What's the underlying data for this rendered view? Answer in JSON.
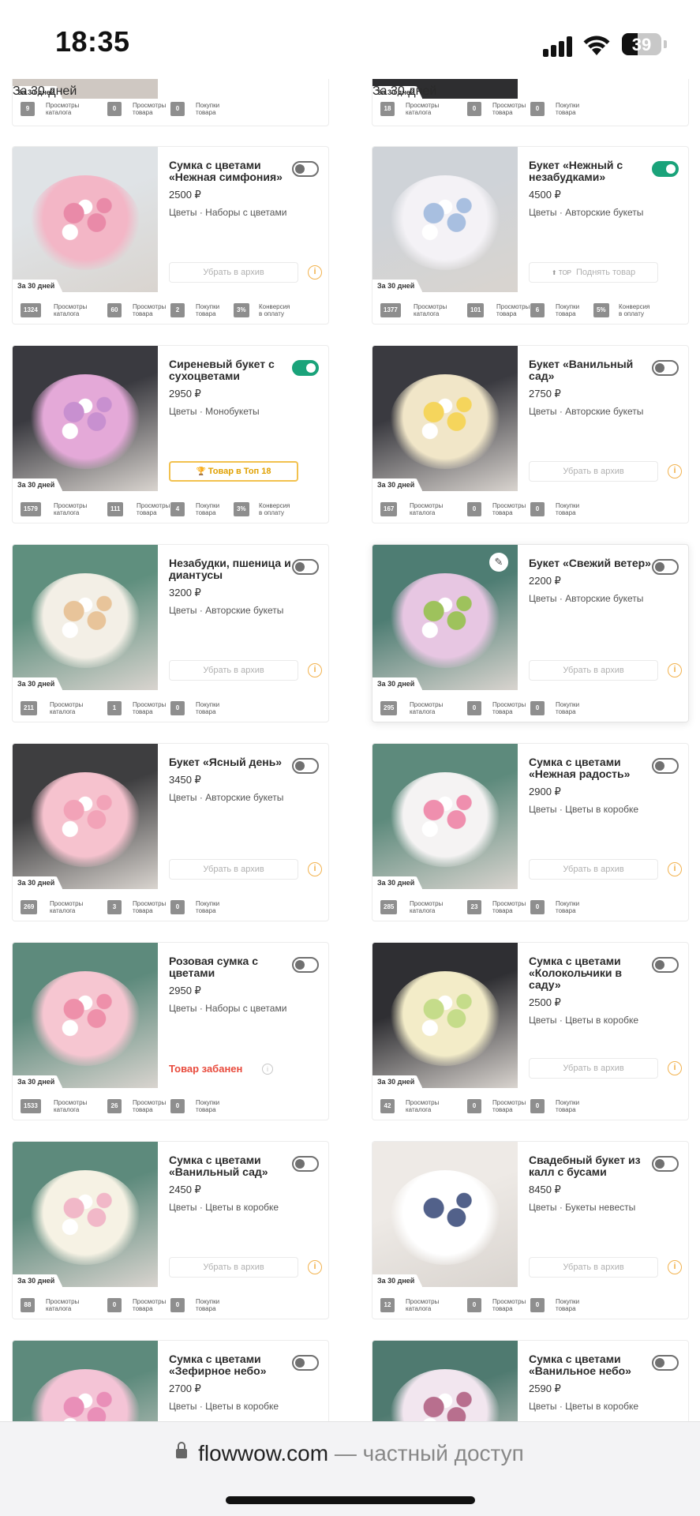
{
  "status": {
    "time": "18:35",
    "battery": "39"
  },
  "stat_labels": {
    "catalog": "Просмотры\nкаталога",
    "product": "Просмотры\nтовара",
    "purchases": "Покупки\nтовара",
    "conversion": "Конверсия\nв оплату"
  },
  "badge_30": "За 30 дней",
  "archive_label": "Убрать в архив",
  "top18_label": "Товар в Топ 18",
  "raise_label": "Поднять товар",
  "raise_mark": "TOP",
  "banned_label": "Товар забанен",
  "top_partial": [
    {
      "catalog": "9",
      "product": "0",
      "purchases": "0"
    },
    {
      "catalog": "18",
      "product": "0",
      "purchases": "0"
    }
  ],
  "products": [
    {
      "title": "Сумка с цветами «Нежная симфония»",
      "price": "2500 ₽",
      "category": "Цветы · Наборы с цветами",
      "enabled": false,
      "action": "archive",
      "stats": {
        "catalog": "1324",
        "product": "60",
        "purchases": "2",
        "conversion": "3%"
      },
      "colors": [
        "#dfe3e6",
        "#f3b6c6",
        "#e98aa8"
      ]
    },
    {
      "title": "Букет «Нежный с незабудками»",
      "price": "4500 ₽",
      "category": "Цветы · Авторские букеты",
      "enabled": true,
      "action": "raise",
      "stats": {
        "catalog": "1377",
        "product": "101",
        "purchases": "6",
        "conversion": "5%"
      },
      "colors": [
        "#cfd3d8",
        "#f4f2f6",
        "#a8bfe0"
      ]
    },
    {
      "title": "Сиреневый букет с сухоцветами",
      "price": "2950 ₽",
      "category": "Цветы · Монобукеты",
      "enabled": true,
      "action": "top18",
      "stats": {
        "catalog": "1579",
        "product": "111",
        "purchases": "4",
        "conversion": "3%"
      },
      "colors": [
        "#3a3a40",
        "#e4a9d8",
        "#c890d0"
      ]
    },
    {
      "title": "Букет «Ванильный сад»",
      "price": "2750 ₽",
      "category": "Цветы · Авторские букеты",
      "enabled": false,
      "action": "archive",
      "stats": {
        "catalog": "167",
        "product": "0",
        "purchases": "0"
      },
      "colors": [
        "#3a3a40",
        "#f1e6c8",
        "#f5d55c"
      ]
    },
    {
      "title": "Незабудки, пшеница и диантусы",
      "price": "3200 ₽",
      "category": "Цветы · Авторские букеты",
      "enabled": false,
      "action": "archive",
      "stats": {
        "catalog": "211",
        "product": "1",
        "purchases": "0"
      },
      "colors": [
        "#5f8f7e",
        "#f3efe6",
        "#e8c49a"
      ]
    },
    {
      "title": "Букет «Свежий ветер»",
      "price": "2200 ₽",
      "category": "Цветы · Авторские букеты",
      "enabled": false,
      "action": "archive",
      "stats": {
        "catalog": "295",
        "product": "0",
        "purchases": "0"
      },
      "colors": [
        "#4e7d73",
        "#e7c6e2",
        "#9ec25c"
      ],
      "edit": true
    },
    {
      "title": "Букет «Ясный день»",
      "price": "3450 ₽",
      "category": "Цветы · Авторские букеты",
      "enabled": false,
      "action": "archive",
      "stats": {
        "catalog": "269",
        "product": "3",
        "purchases": "0"
      },
      "colors": [
        "#3e3e40",
        "#f6c2ce",
        "#f2a3b8"
      ]
    },
    {
      "title": "Сумка с цветами «Нежная радость»",
      "price": "2900 ₽",
      "category": "Цветы · Цветы в коробке",
      "enabled": false,
      "action": "archive",
      "stats": {
        "catalog": "285",
        "product": "23",
        "purchases": "0"
      },
      "colors": [
        "#5d8a7c",
        "#f5f3f3",
        "#ef8fae"
      ]
    },
    {
      "title": "Розовая сумка с цветами",
      "price": "2950 ₽",
      "category": "Цветы · Наборы с цветами",
      "enabled": false,
      "action": "banned",
      "stats": {
        "catalog": "1533",
        "product": "26",
        "purchases": "0"
      },
      "colors": [
        "#5d8a7c",
        "#f6c6d1",
        "#ee90aa"
      ]
    },
    {
      "title": "Сумка с цветами «Колокольчики в саду»",
      "price": "2500 ₽",
      "category": "Цветы · Цветы в коробке",
      "enabled": false,
      "action": "archive",
      "stats": {
        "catalog": "42",
        "product": "0",
        "purchases": "0"
      },
      "colors": [
        "#2f2f33",
        "#f3ecc8",
        "#c5dc8a"
      ]
    },
    {
      "title": "Сумка с цветами «Ванильный сад»",
      "price": "2450 ₽",
      "category": "Цветы · Цветы в коробке",
      "enabled": false,
      "action": "archive",
      "stats": {
        "catalog": "88",
        "product": "0",
        "purchases": "0"
      },
      "colors": [
        "#5d8a7c",
        "#f6f2e4",
        "#f1b8c8"
      ]
    },
    {
      "title": "Свадебный букет из калл с бусами",
      "price": "8450 ₽",
      "category": "Цветы · Букеты невесты",
      "enabled": false,
      "action": "archive",
      "stats": {
        "catalog": "12",
        "product": "0",
        "purchases": "0"
      },
      "colors": [
        "#eeeae6",
        "#ffffff",
        "#52618a"
      ]
    },
    {
      "title": "Сумка с цветами «Зефирное небо»",
      "price": "2700 ₽",
      "category": "Цветы · Цветы в коробке",
      "enabled": false,
      "action": "none",
      "stats": {},
      "colors": [
        "#5d8a7c",
        "#f4c4d6",
        "#e98fb8"
      ]
    },
    {
      "title": "Сумка с цветами «Ванильное небо»",
      "price": "2590 ₽",
      "category": "Цветы · Цветы в коробке",
      "enabled": false,
      "action": "none",
      "stats": {},
      "colors": [
        "#4f7a70",
        "#f2e6ef",
        "#b86f8e"
      ]
    }
  ],
  "browser": {
    "host": "flowwow.com",
    "sub": "— частный доступ"
  }
}
